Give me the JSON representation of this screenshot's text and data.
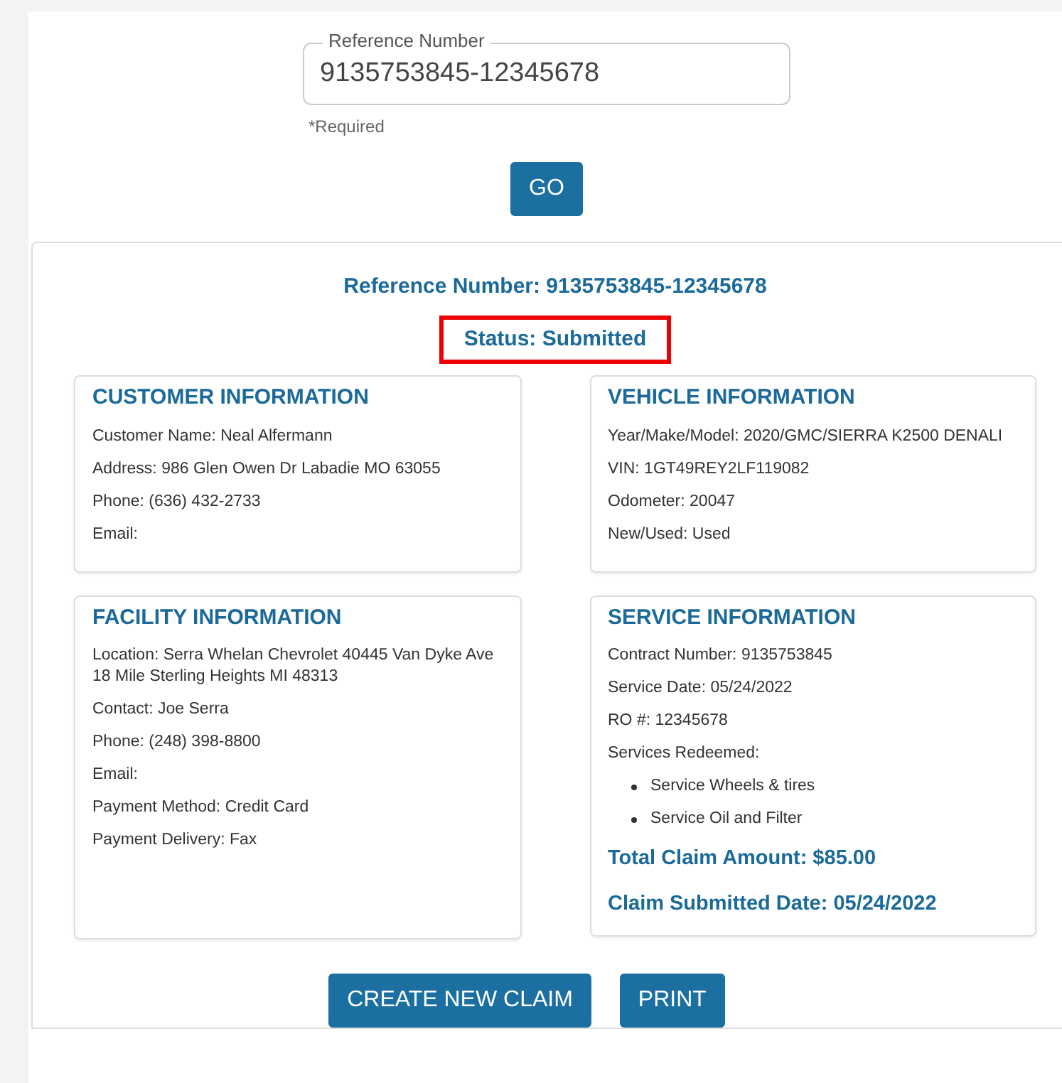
{
  "lookup": {
    "label": "Reference Number",
    "value": "9135753845-12345678",
    "hint": "*Required",
    "button": "GO"
  },
  "result": {
    "reference": "Reference Number: 9135753845-12345678",
    "status": {
      "text": "Status: Submitted",
      "highlighted": true
    },
    "left_cards": [
      {
        "title": "CUSTOMER INFORMATION",
        "lines": [
          "Customer Name: Neal Alfermann",
          "Address: 986 Glen Owen Dr Labadie MO 63055",
          "Phone: (636) 432-2733",
          "Email:"
        ]
      },
      {
        "title": "FACILITY INFORMATION",
        "lines": [
          "Location: Serra Whelan Chevrolet 40445 Van Dyke Ave 18 Mile Sterling Heights MI 48313",
          "Contact: Joe Serra",
          "Phone: (248) 398-8800",
          "Email:",
          "Payment Method: Credit Card",
          "Payment Delivery: Fax"
        ]
      }
    ],
    "right_cards": [
      {
        "title": "VEHICLE INFORMATION",
        "lines": [
          "Year/Make/Model: 2020/GMC/SIERRA K2500 DENALI",
          "VIN: 1GT49REY2LF119082",
          "Odometer: 20047",
          "New/Used: Used"
        ]
      },
      {
        "title": "SERVICE INFORMATION",
        "lines": [
          "Contract Number: 9135753845",
          "Service Date: 05/24/2022",
          "RO #: 12345678",
          "Services Redeemed:"
        ],
        "services": [
          "Service Wheels & tires",
          "Service Oil and Filter"
        ],
        "totals": [
          "Total Claim Amount: $85.00",
          "Claim Submitted Date: 05/24/2022"
        ]
      }
    ]
  },
  "buttons": [
    "CREATE NEW CLAIM",
    "PRINT"
  ]
}
